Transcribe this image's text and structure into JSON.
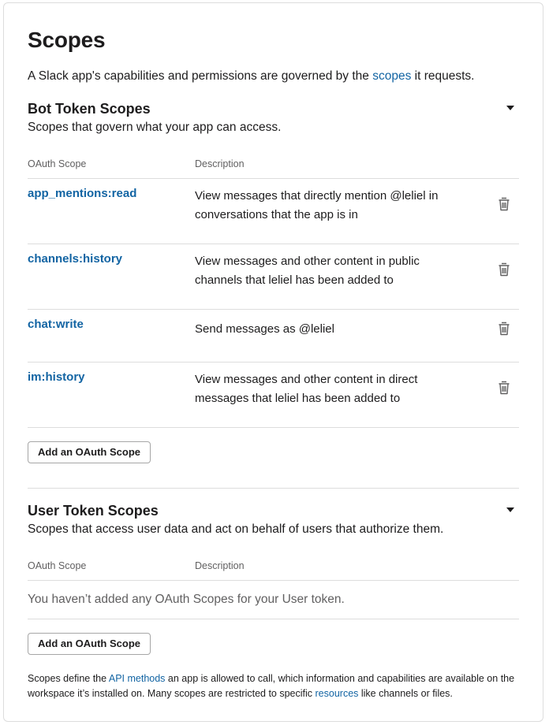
{
  "page": {
    "title": "Scopes",
    "intro_before": "A Slack app's capabilities and permissions are governed by the ",
    "intro_link": "scopes",
    "intro_after": " it requests."
  },
  "bot": {
    "title": "Bot Token Scopes",
    "subtitle": "Scopes that govern what your app can access.",
    "col_scope": "OAuth Scope",
    "col_desc": "Description",
    "rows": [
      {
        "name": "app_mentions:read",
        "desc": "View messages that directly mention @leliel in conversations that the app is in"
      },
      {
        "name": "channels:history",
        "desc": "View messages and other content in public channels that leliel has been added to"
      },
      {
        "name": "chat:write",
        "desc": "Send messages as @leliel"
      },
      {
        "name": "im:history",
        "desc": "View messages and other content in direct messages that leliel has been added to"
      }
    ],
    "add_button": "Add an OAuth Scope"
  },
  "user": {
    "title": "User Token Scopes",
    "subtitle": "Scopes that access user data and act on behalf of users that authorize them.",
    "col_scope": "OAuth Scope",
    "col_desc": "Description",
    "empty": "You haven’t added any OAuth Scopes for your User token.",
    "add_button": "Add an OAuth Scope"
  },
  "footer": {
    "t1": "Scopes define the ",
    "link1": "API methods",
    "t2": " an app is allowed to call, which information and capabilities are available on the workspace it’s installed on. Many scopes are restricted to specific ",
    "link2": "resources",
    "t3": " like channels or files."
  },
  "colors": {
    "link": "#1264a3",
    "text": "#1d1c1d",
    "muted": "#616061",
    "border": "#dddddd"
  },
  "icons": {
    "row_action": "trash-icon",
    "collapse": "caret-down-icon"
  }
}
